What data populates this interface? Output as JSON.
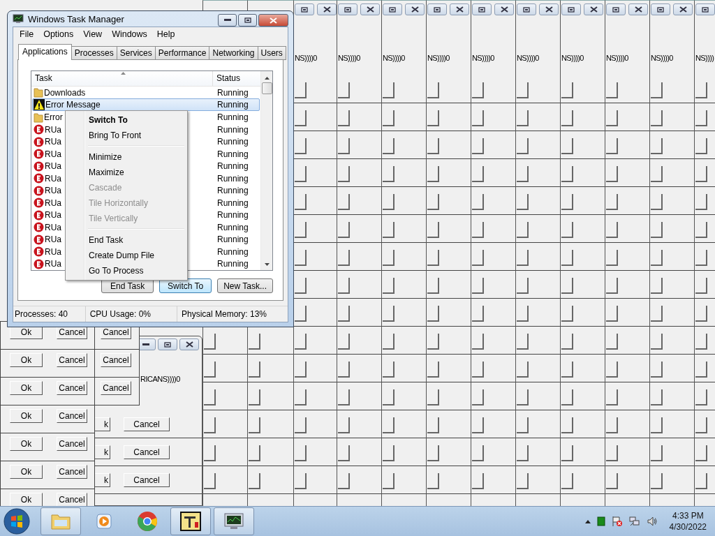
{
  "stacked_windows": [
    {
      "caption": "NS))))0"
    },
    {
      "caption": "NS))))0"
    },
    {
      "caption": "NS))))0"
    },
    {
      "caption": "NS))))0"
    },
    {
      "caption": "NS))))0"
    },
    {
      "caption": "NS))))0"
    },
    {
      "caption": "NS))))0"
    },
    {
      "caption": "NS))))0"
    },
    {
      "caption": "NS))))0"
    },
    {
      "caption": "NS))))"
    }
  ],
  "middle_dialog": {
    "caption": "RICANS))))0",
    "rows": [
      {
        "ok": "k",
        "cancel": "Cancel"
      },
      {
        "ok": "k",
        "cancel": "Cancel"
      },
      {
        "ok": "k",
        "cancel": "Cancel"
      }
    ]
  },
  "ok_cancel_dialogs": [
    {
      "ok": "Ok",
      "cancel": "Cancel"
    },
    {
      "ok": "Ok",
      "cancel": "Cancel"
    },
    {
      "ok": "Ok",
      "cancel": "Cancel"
    },
    {
      "ok": "Ok",
      "cancel": "Cancel"
    },
    {
      "ok": "Ok",
      "cancel": "Cancel"
    },
    {
      "ok": "Ok",
      "cancel": "Cancel"
    },
    {
      "ok": "Ok",
      "cancel": "Cancel"
    }
  ],
  "side_dialogs": [
    {
      "cancel": "Cancel"
    },
    {
      "cancel": "Cancel"
    },
    {
      "cancel": "Cancel"
    }
  ],
  "task_manager": {
    "title": "Windows Task Manager",
    "menu": [
      "File",
      "Options",
      "View",
      "Windows",
      "Help"
    ],
    "tabs": [
      {
        "label": "Applications",
        "selected": true
      },
      {
        "label": "Processes",
        "selected": false
      },
      {
        "label": "Services",
        "selected": false
      },
      {
        "label": "Performance",
        "selected": false
      },
      {
        "label": "Networking",
        "selected": false
      },
      {
        "label": "Users",
        "selected": false
      }
    ],
    "columns": [
      "Task",
      "Status"
    ],
    "rows": [
      {
        "kind": "folder",
        "task": "Downloads",
        "status": "Running",
        "selected": false
      },
      {
        "kind": "warning",
        "task": "Error Message",
        "status": "Running",
        "selected": true
      },
      {
        "kind": "folder",
        "task": "Error",
        "status": "Running",
        "selected": false
      },
      {
        "kind": "error",
        "task": "RUa",
        "status": "Running",
        "selected": false
      },
      {
        "kind": "error",
        "task": "RUa",
        "status": "Running",
        "selected": false
      },
      {
        "kind": "error",
        "task": "RUa",
        "status": "Running",
        "selected": false
      },
      {
        "kind": "error",
        "task": "RUa",
        "status": "Running",
        "selected": false
      },
      {
        "kind": "error",
        "task": "RUa",
        "status": "Running",
        "selected": false
      },
      {
        "kind": "error",
        "task": "RUa",
        "status": "Running",
        "selected": false
      },
      {
        "kind": "error",
        "task": "RUa",
        "status": "Running",
        "selected": false
      },
      {
        "kind": "error",
        "task": "RUa",
        "status": "Running",
        "selected": false
      },
      {
        "kind": "error",
        "task": "RUa",
        "status": "Running",
        "selected": false
      },
      {
        "kind": "error",
        "task": "RUa",
        "status": "Running",
        "selected": false
      },
      {
        "kind": "error",
        "task": "RUa",
        "status": "Running",
        "selected": false
      },
      {
        "kind": "error",
        "task": "RUa",
        "status": "Running",
        "selected": false
      }
    ],
    "buttons": [
      {
        "label": "End Task",
        "default": false
      },
      {
        "label": "Switch To",
        "default": true
      },
      {
        "label": "New Task...",
        "default": false
      }
    ],
    "status_bar": [
      "Processes: 40",
      "CPU Usage: 0%",
      "Physical Memory: 13%"
    ]
  },
  "context_menu": [
    {
      "kind": "item",
      "label": "Switch To",
      "bold": true,
      "disabled": false
    },
    {
      "kind": "item",
      "label": "Bring To Front",
      "bold": false,
      "disabled": false
    },
    {
      "kind": "separator"
    },
    {
      "kind": "item",
      "label": "Minimize",
      "bold": false,
      "disabled": false
    },
    {
      "kind": "item",
      "label": "Maximize",
      "bold": false,
      "disabled": false
    },
    {
      "kind": "item",
      "label": "Cascade",
      "bold": false,
      "disabled": true
    },
    {
      "kind": "item",
      "label": "Tile Horizontally",
      "bold": false,
      "disabled": true
    },
    {
      "kind": "item",
      "label": "Tile Vertically",
      "bold": false,
      "disabled": true
    },
    {
      "kind": "separator"
    },
    {
      "kind": "item",
      "label": "End Task",
      "bold": false,
      "disabled": false
    },
    {
      "kind": "item",
      "label": "Create Dump File",
      "bold": false,
      "disabled": false
    },
    {
      "kind": "item",
      "label": "Go To Process",
      "bold": false,
      "disabled": false
    }
  ],
  "taskbar": {
    "apps": [
      {
        "kind": "explorer",
        "running": true
      },
      {
        "kind": "media",
        "running": false
      },
      {
        "kind": "chrome",
        "running": false
      },
      {
        "kind": "tools",
        "running": true
      },
      {
        "kind": "monitor",
        "running": true
      }
    ],
    "time": "4:33 PM",
    "date": "4/30/2022"
  }
}
